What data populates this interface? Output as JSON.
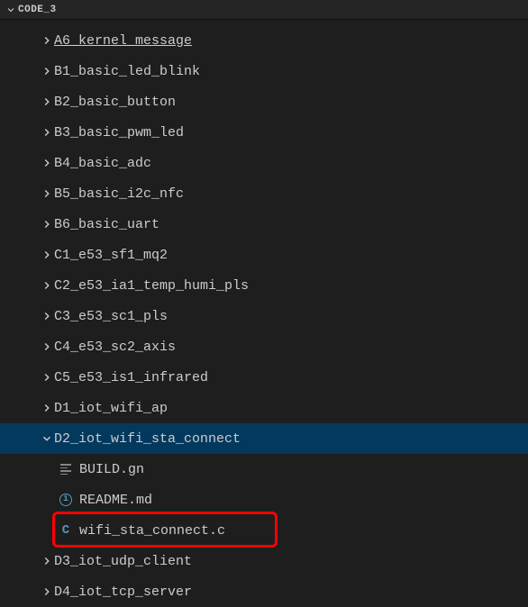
{
  "header": {
    "title": "CODE_3"
  },
  "tree": {
    "items": [
      {
        "type": "folder",
        "state": "collapsed",
        "depth": 1,
        "label": "A6_kernel_message",
        "selected": false,
        "cutoff": true
      },
      {
        "type": "folder",
        "state": "collapsed",
        "depth": 1,
        "label": "B1_basic_led_blink",
        "selected": false
      },
      {
        "type": "folder",
        "state": "collapsed",
        "depth": 1,
        "label": "B2_basic_button",
        "selected": false
      },
      {
        "type": "folder",
        "state": "collapsed",
        "depth": 1,
        "label": "B3_basic_pwm_led",
        "selected": false
      },
      {
        "type": "folder",
        "state": "collapsed",
        "depth": 1,
        "label": "B4_basic_adc",
        "selected": false
      },
      {
        "type": "folder",
        "state": "collapsed",
        "depth": 1,
        "label": "B5_basic_i2c_nfc",
        "selected": false
      },
      {
        "type": "folder",
        "state": "collapsed",
        "depth": 1,
        "label": "B6_basic_uart",
        "selected": false
      },
      {
        "type": "folder",
        "state": "collapsed",
        "depth": 1,
        "label": "C1_e53_sf1_mq2",
        "selected": false
      },
      {
        "type": "folder",
        "state": "collapsed",
        "depth": 1,
        "label": "C2_e53_ia1_temp_humi_pls",
        "selected": false
      },
      {
        "type": "folder",
        "state": "collapsed",
        "depth": 1,
        "label": "C3_e53_sc1_pls",
        "selected": false
      },
      {
        "type": "folder",
        "state": "collapsed",
        "depth": 1,
        "label": "C4_e53_sc2_axis",
        "selected": false
      },
      {
        "type": "folder",
        "state": "collapsed",
        "depth": 1,
        "label": "C5_e53_is1_infrared",
        "selected": false
      },
      {
        "type": "folder",
        "state": "collapsed",
        "depth": 1,
        "label": "D1_iot_wifi_ap",
        "selected": false
      },
      {
        "type": "folder",
        "state": "expanded",
        "depth": 1,
        "label": "D2_iot_wifi_sta_connect",
        "selected": true
      },
      {
        "type": "file",
        "icon": "lines",
        "depth": 2,
        "label": "BUILD.gn",
        "selected": false
      },
      {
        "type": "file",
        "icon": "info",
        "depth": 2,
        "label": "README.md",
        "selected": false
      },
      {
        "type": "file",
        "icon": "c",
        "depth": 2,
        "label": "wifi_sta_connect.c",
        "selected": false,
        "highlighted": true
      },
      {
        "type": "folder",
        "state": "collapsed",
        "depth": 1,
        "label": "D3_iot_udp_client",
        "selected": false
      },
      {
        "type": "folder",
        "state": "collapsed",
        "depth": 1,
        "label": "D4_iot_tcp_server",
        "selected": false
      }
    ]
  }
}
